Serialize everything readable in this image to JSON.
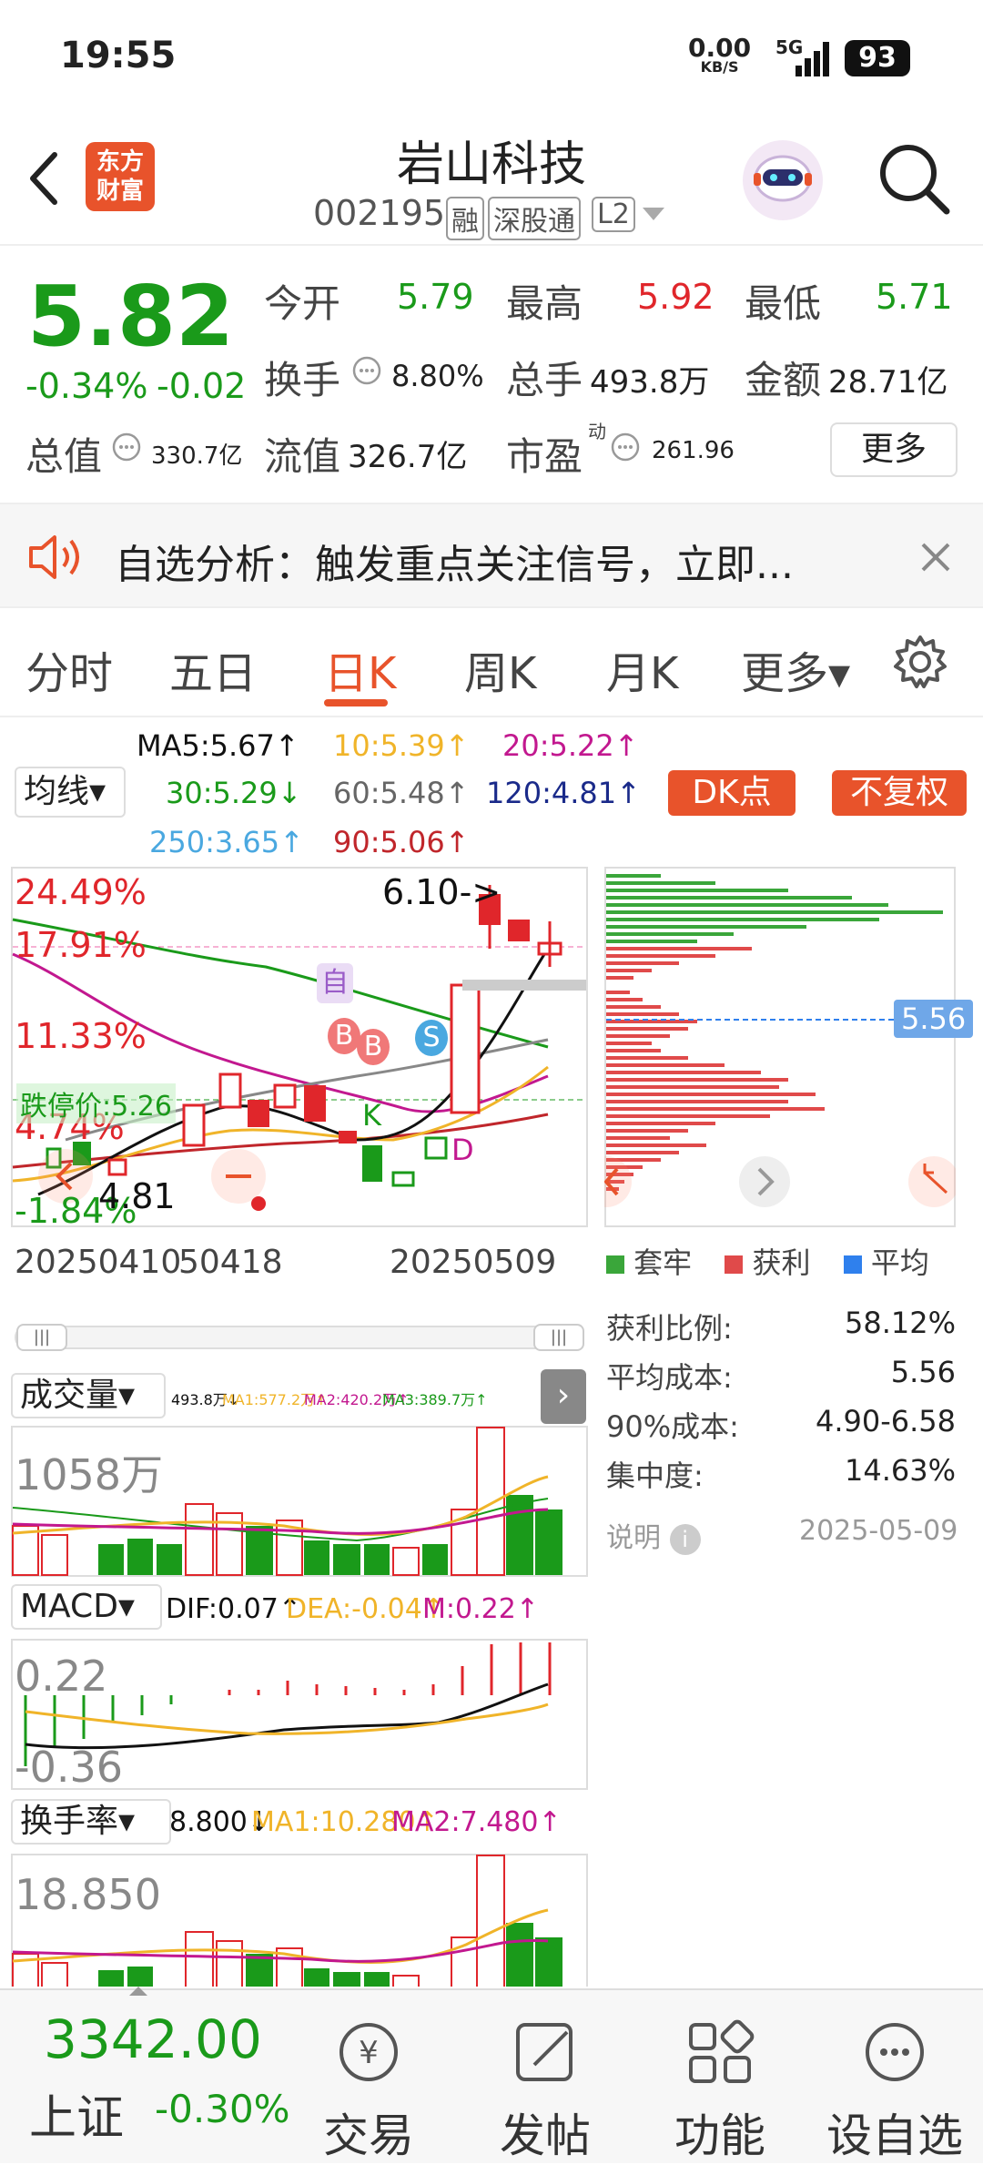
{
  "status_bar": {
    "time": "19:55",
    "net_speed": "0.00",
    "net_unit": "KB/S",
    "network": "5G",
    "battery": "93"
  },
  "header": {
    "logo_text_1": "东方",
    "logo_text_2": "财富",
    "stock_name": "岩山科技",
    "stock_code": "002195",
    "badge_rong": "融",
    "badge_sgt": "深股通",
    "badge_l2": "L2"
  },
  "quote": {
    "price": "5.82",
    "change_pct": "-0.34%",
    "change": "-0.02",
    "open_label": "今开",
    "open": "5.79",
    "high_label": "最高",
    "high": "5.92",
    "low_label": "最低",
    "low": "5.71",
    "turnover_label": "换手",
    "turnover": "8.80%",
    "volume_label": "总手",
    "volume": "493.8万",
    "amount_label": "金额",
    "amount": "28.71亿",
    "mktcap_label": "总值",
    "mktcap": "330.7亿",
    "float_label": "流值",
    "float_cap": "326.7亿",
    "pe_label": "市盈",
    "pe_sup": "动",
    "pe": "261.96",
    "more": "更多"
  },
  "banner": {
    "text": "自选分析：触发重点关注信号，立即..."
  },
  "tabs": [
    {
      "label": "分时"
    },
    {
      "label": "五日"
    },
    {
      "label": "日K"
    },
    {
      "label": "周K"
    },
    {
      "label": "月K"
    },
    {
      "label": "更多▾"
    }
  ],
  "ma": {
    "selector": "均线▾",
    "ma5": "MA5:5.67↑",
    "ma10": "10:5.39↑",
    "ma20": "20:5.22↑",
    "ma30": "30:5.29↓",
    "ma60": "60:5.48↑",
    "ma120": "120:4.81↑",
    "ma250": "250:3.65↑",
    "ma90": "90:5.06↑",
    "dk_button": "DK点",
    "fq_button": "不复权"
  },
  "kline": {
    "pct_labels": [
      "24.49%",
      "17.91%",
      "11.33%",
      "4.74%",
      "-1.84%"
    ],
    "price_high_note": "6.10->",
    "price_low_note": "4.81",
    "limit_down": "跌停价:5.26",
    "dates": [
      "20250410",
      "50418",
      "20250509"
    ],
    "markers": {
      "zi": "自",
      "b1": "B",
      "b2": "B",
      "s": "S",
      "k": "K",
      "d": "D"
    },
    "colors": {
      "up": "#e0262b",
      "down": "#1a9a1a"
    }
  },
  "chip": {
    "avg_label": "5.56",
    "legend": [
      {
        "name": "套牢",
        "color": "#3aa63a"
      },
      {
        "name": "获利",
        "color": "#e04a4a"
      },
      {
        "name": "平均",
        "color": "#2f80ed"
      }
    ],
    "stats": [
      {
        "label": "获利比例:",
        "value": "58.12%"
      },
      {
        "label": "平均成本:",
        "value": "5.56"
      },
      {
        "label": "90%成本:",
        "value": "4.90-6.58"
      },
      {
        "label": "集中度:",
        "value": "14.63%"
      }
    ],
    "note_label": "说明",
    "note_date": "2025-05-09"
  },
  "volume": {
    "selector": "成交量▾",
    "summary": "493.8万↓",
    "ma1": "MA1:577.2万↑",
    "ma2": "MA2:420.2万↑",
    "ma3": "MA3:389.7万↑",
    "axis_label": "1058万"
  },
  "macd": {
    "selector": "MACD▾",
    "dif": "DIF:0.07↑",
    "dea": "DEA:-0.04↑",
    "m": "M:0.22↑",
    "axis_top": "0.22",
    "axis_bottom": "-0.36"
  },
  "turnover_panel": {
    "selector": "换手率▾",
    "value": "8.800↓",
    "ma1": "MA1:10.280↑",
    "ma2": "MA2:7.480↑",
    "axis_label": "18.850"
  },
  "bottom": {
    "index_value": "3342.00",
    "index_name": "上证",
    "index_change": "-0.30%",
    "nav": [
      {
        "label": "交易"
      },
      {
        "label": "发帖"
      },
      {
        "label": "功能"
      },
      {
        "label": "设自选"
      }
    ]
  }
}
